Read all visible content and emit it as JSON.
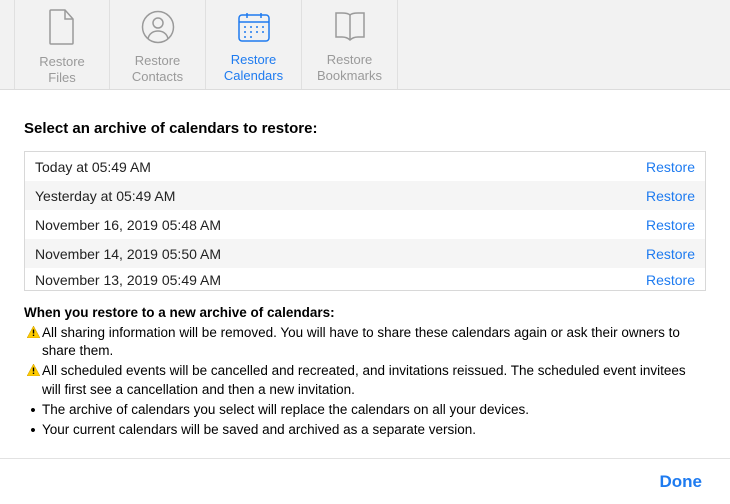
{
  "toolbar": {
    "items": [
      {
        "label1": "Restore",
        "label2": "Files",
        "active": false,
        "icon": "file-icon"
      },
      {
        "label1": "Restore",
        "label2": "Contacts",
        "active": false,
        "icon": "contact-icon"
      },
      {
        "label1": "Restore",
        "label2": "Calendars",
        "active": true,
        "icon": "calendar-icon"
      },
      {
        "label1": "Restore",
        "label2": "Bookmarks",
        "active": false,
        "icon": "bookmark-icon"
      }
    ]
  },
  "section_title": "Select an archive of calendars to restore:",
  "archives": [
    {
      "timestamp": "Today at 05:49 AM",
      "action": "Restore"
    },
    {
      "timestamp": "Yesterday at 05:49 AM",
      "action": "Restore"
    },
    {
      "timestamp": "November 16, 2019 05:48 AM",
      "action": "Restore"
    },
    {
      "timestamp": "November 14, 2019 05:50 AM",
      "action": "Restore"
    },
    {
      "timestamp": "November 13, 2019 05:49 AM",
      "action": "Restore"
    }
  ],
  "notes": {
    "title": "When you restore to a new archive of calendars:",
    "items": [
      {
        "kind": "warning",
        "text": "All sharing information will be removed. You will have to share these calendars again or ask their owners to share them."
      },
      {
        "kind": "warning",
        "text": "All scheduled events will be cancelled and recreated, and invitations reissued. The scheduled event invitees will first see a cancellation and then a new invitation."
      },
      {
        "kind": "bullet",
        "text": "The archive of calendars you select will replace the calendars on all your devices."
      },
      {
        "kind": "bullet",
        "text": "Your current calendars will be saved and archived as a separate version."
      }
    ]
  },
  "footer": {
    "done_label": "Done"
  }
}
